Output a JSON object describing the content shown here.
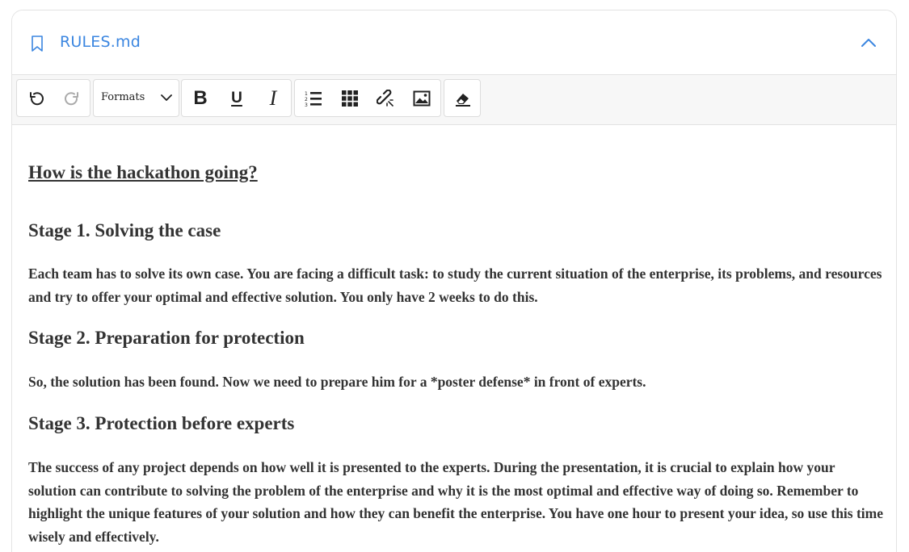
{
  "header": {
    "file_name": "RULES.md"
  },
  "toolbar": {
    "formats_label": "Formats",
    "bold_label": "B",
    "underline_label": "U",
    "italic_label": "I"
  },
  "document": {
    "title": "How is the hackathon going?",
    "sections": [
      {
        "heading": "Stage 1. Solving the case",
        "text": "Each team has to solve its own case. You are facing a difficult task: to study the current situation of the enterprise, its problems, and resources and try to offer your optimal and effective solution. You only have 2 weeks to do this."
      },
      {
        "heading": "Stage 2. Preparation for protection",
        "text": "So, the solution has been found. Now we need to prepare him for a *poster defense* in front of experts."
      },
      {
        "heading": "Stage 3. Protection before experts",
        "text": "The success of any project depends on how well it is presented to the experts. During the presentation, it is crucial to explain how your solution can contribute to solving the problem of the enterprise and why it is the most optimal and effective way of doing so. Remember to highlight the unique features of your solution and how they can benefit the enterprise. You have one hour to present your idea, so use this time wisely and effectively."
      }
    ]
  },
  "colors": {
    "accent": "#3b86e0",
    "text": "#333333",
    "border": "#e3e3e3",
    "toolbar_bg": "#f7f7f7"
  }
}
